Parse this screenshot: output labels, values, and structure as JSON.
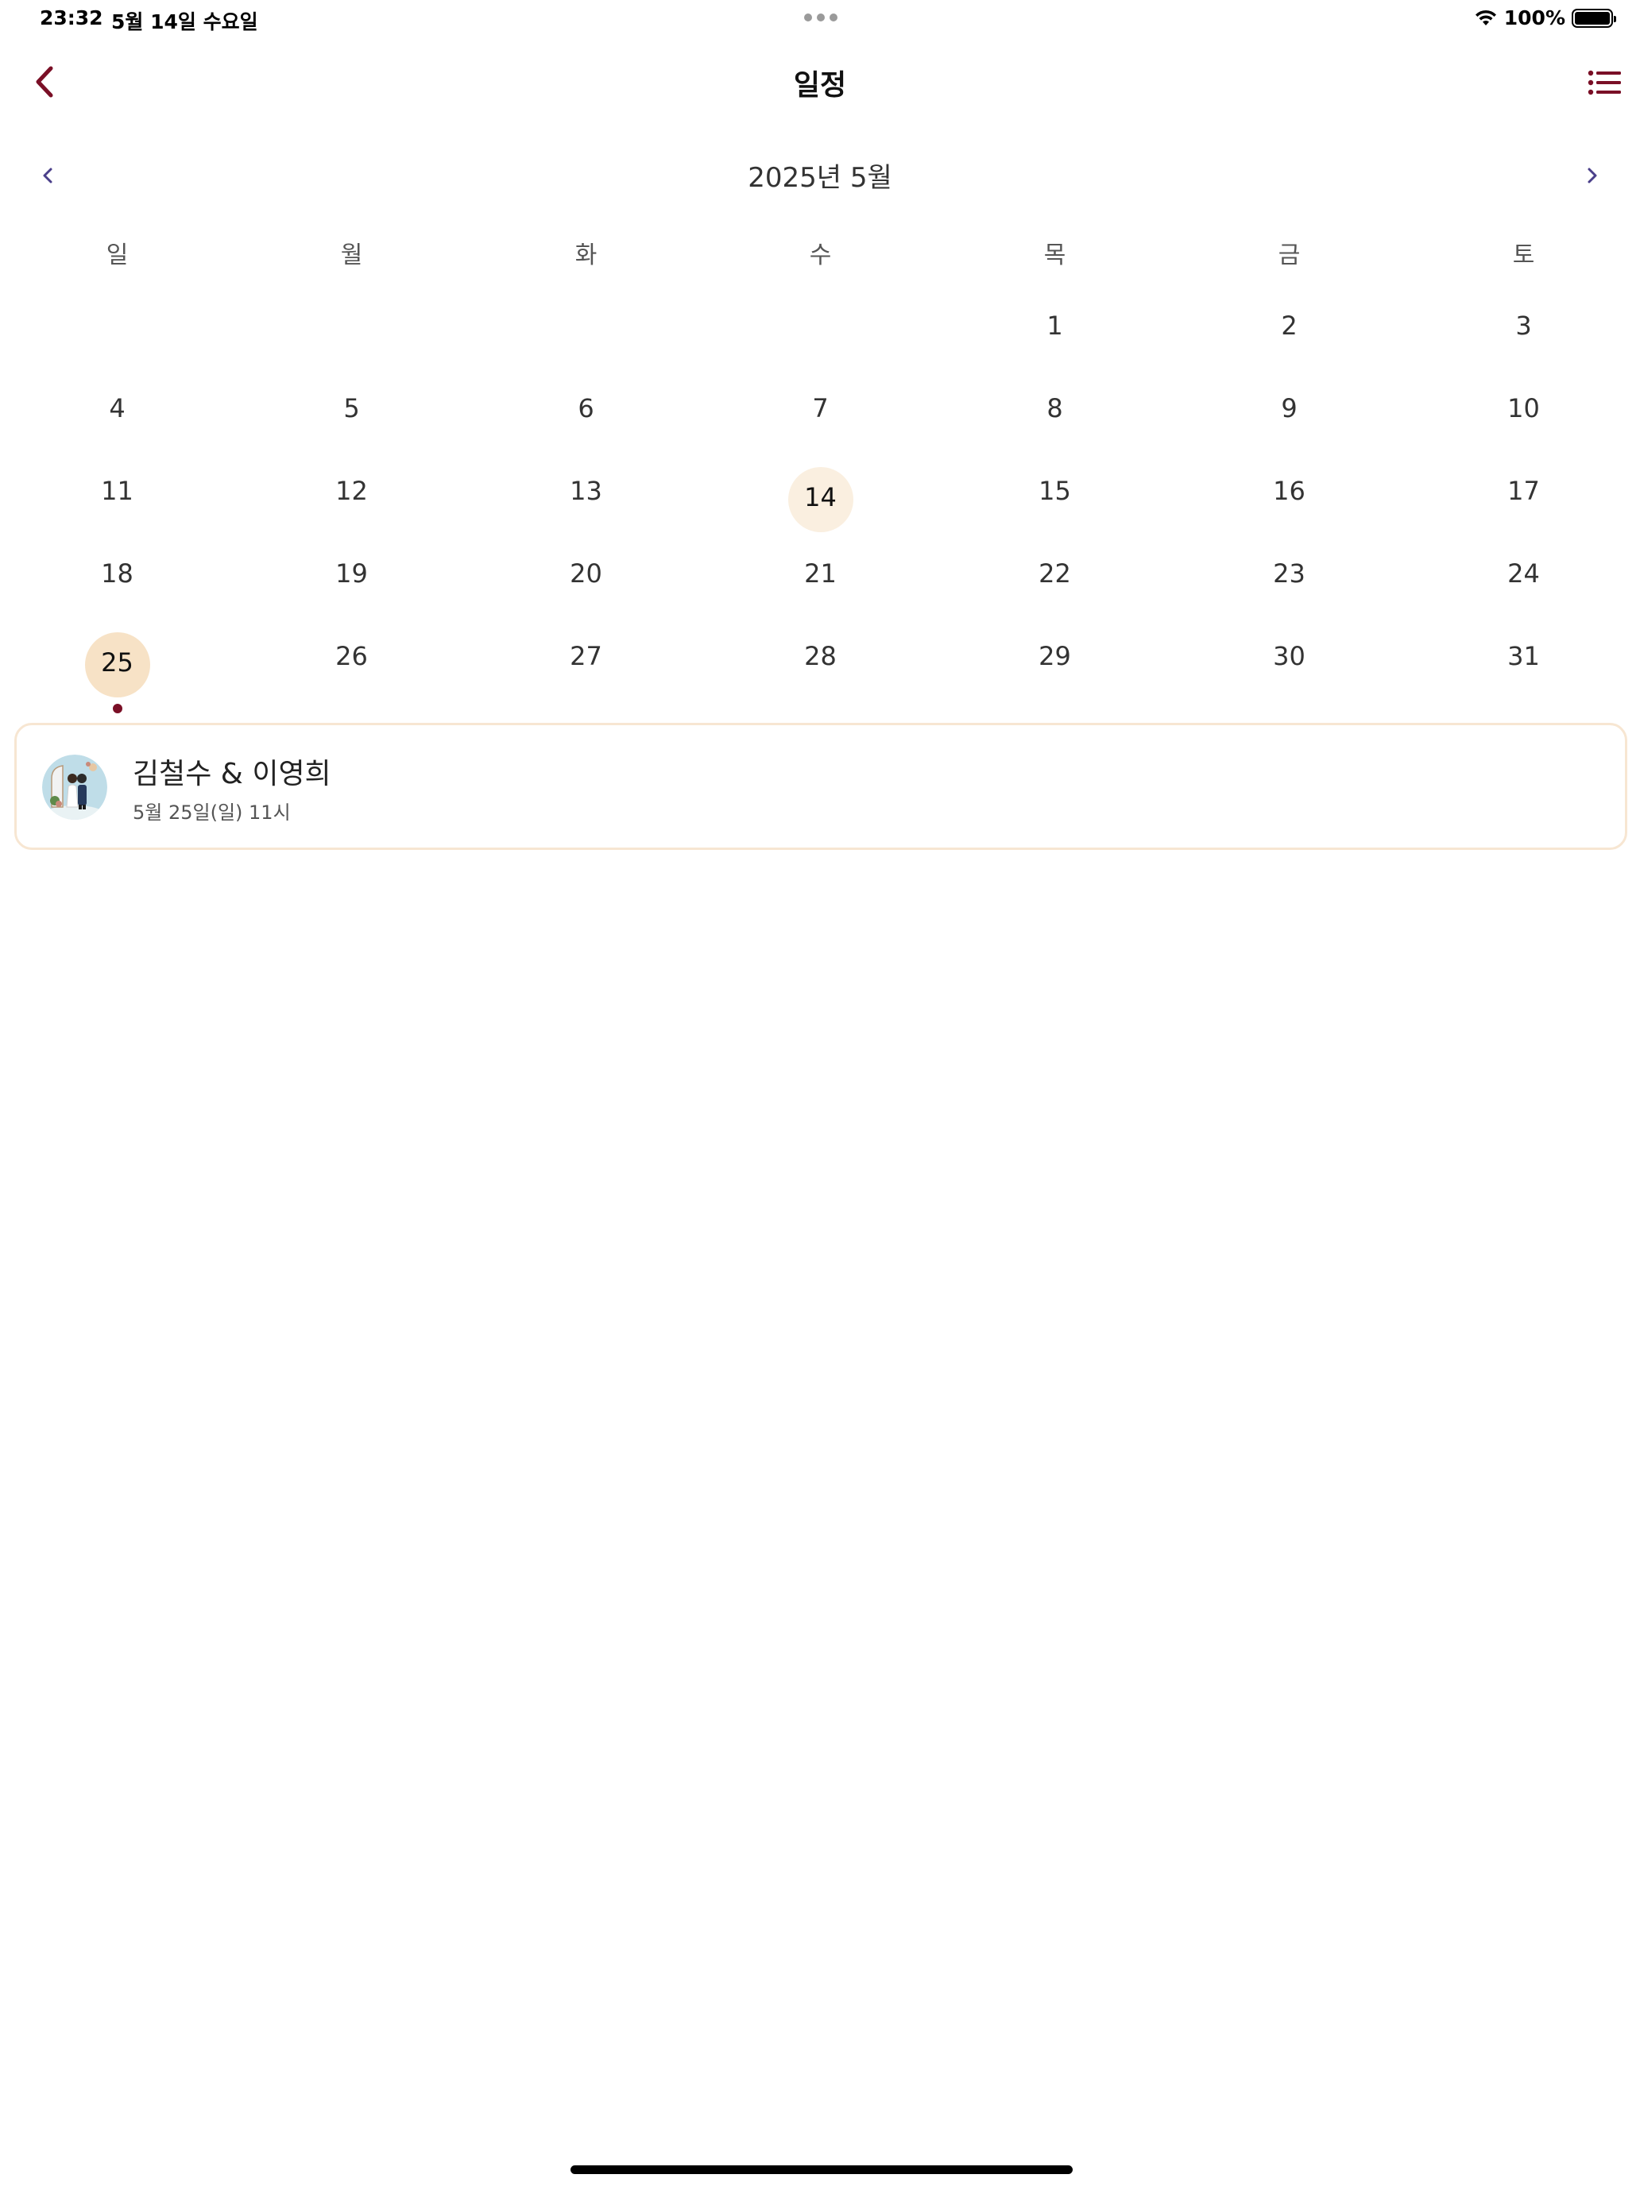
{
  "status_bar": {
    "time": "23:32",
    "date": "5월 14일 수요일",
    "battery": "100%",
    "battery_level": 1.0
  },
  "nav": {
    "title": "일정",
    "accent_color": "#7a0f26"
  },
  "calendar": {
    "month_label": "2025년 5월",
    "weekdays": [
      "일",
      "월",
      "화",
      "수",
      "목",
      "금",
      "토"
    ],
    "days": [
      "",
      "",
      "",
      "",
      "1",
      "2",
      "3",
      "4",
      "5",
      "6",
      "7",
      "8",
      "9",
      "10",
      "11",
      "12",
      "13",
      "14",
      "15",
      "16",
      "17",
      "18",
      "19",
      "20",
      "21",
      "22",
      "23",
      "24",
      "25",
      "26",
      "27",
      "28",
      "29",
      "30",
      "31"
    ],
    "today": "14",
    "selected": "25",
    "event_days": [
      "25"
    ],
    "today_color": "#faefe0",
    "selected_color": "#f7e2c6"
  },
  "event": {
    "title": "김철수 & 이영희",
    "subtitle": "5월 25일(일) 11시",
    "avatar_icon": "wedding-couple-icon",
    "border_color": "#f7e6d2"
  }
}
